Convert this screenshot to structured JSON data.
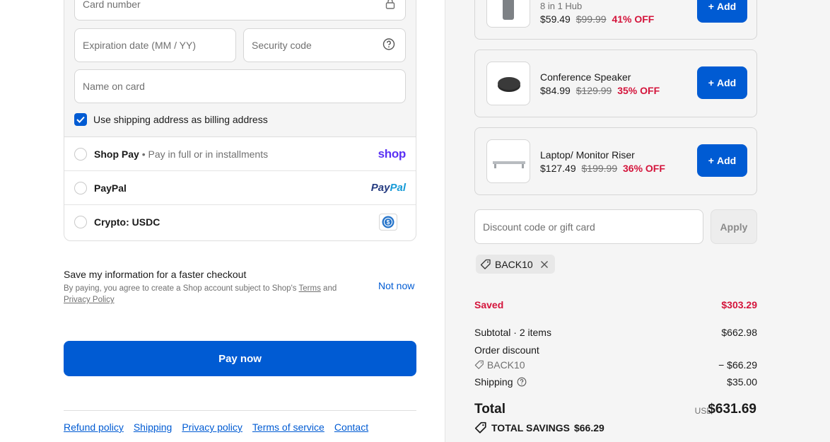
{
  "payment": {
    "card_number_placeholder": "Card number",
    "expiration_placeholder": "Expiration date (MM / YY)",
    "security_code_placeholder": "Security code",
    "name_on_card_placeholder": "Name on card",
    "use_shipping_label": "Use shipping address as billing address",
    "use_shipping_checked": true,
    "options": [
      {
        "name": "Shop Pay",
        "sub": "• Pay in full or in installments",
        "logo": "shop"
      },
      {
        "name": "PayPal",
        "sub": "",
        "logo": "PayPal"
      },
      {
        "name": "Crypto: USDC",
        "sub": "",
        "logo": "usdc-icon"
      }
    ]
  },
  "save_info": {
    "title": "Save my information for a faster checkout",
    "legal_prefix": "By paying, you agree to create a Shop account subject to Shop's",
    "terms_link": "Terms",
    "and": "and",
    "privacy_link": "Privacy Policy",
    "not_now": "Not now"
  },
  "pay_now_label": "Pay now",
  "footer_links": [
    "Refund policy",
    "Shipping",
    "Privacy policy",
    "Terms of service",
    "Contact"
  ],
  "products": [
    {
      "name": "8 in 1 Hub",
      "price": "$59.49",
      "original": "$99.99",
      "off": "41% OFF",
      "button": "Add"
    },
    {
      "name": "Conference Speaker",
      "price": "$84.99",
      "original": "$129.99",
      "off": "35% OFF",
      "button": "Add"
    },
    {
      "name": "Laptop/ Monitor Riser",
      "price": "$127.49",
      "original": "$199.99",
      "off": "36% OFF",
      "button": "Add"
    }
  ],
  "discount": {
    "placeholder": "Discount code or gift card",
    "apply_label": "Apply",
    "applied_code": "BACK10"
  },
  "summary": {
    "saved_label": "Saved",
    "saved_value": "$303.29",
    "subtotal_label": "Subtotal · 2 items",
    "subtotal_value": "$662.98",
    "order_discount_label": "Order discount",
    "discount_code": "BACK10",
    "discount_value": "− $66.29",
    "shipping_label": "Shipping",
    "shipping_value": "$35.00",
    "total_label": "Total",
    "currency": "USD",
    "total_value": "$631.69",
    "total_savings_label": "TOTAL SAVINGS",
    "total_savings_value": "$66.29"
  },
  "colors": {
    "accent": "#005bd3",
    "sale": "#d4143b",
    "shop_purple": "#5a31f4",
    "paypal_dark": "#253b80",
    "paypal_light": "#179bd7",
    "usdc_blue": "#2775ca"
  }
}
